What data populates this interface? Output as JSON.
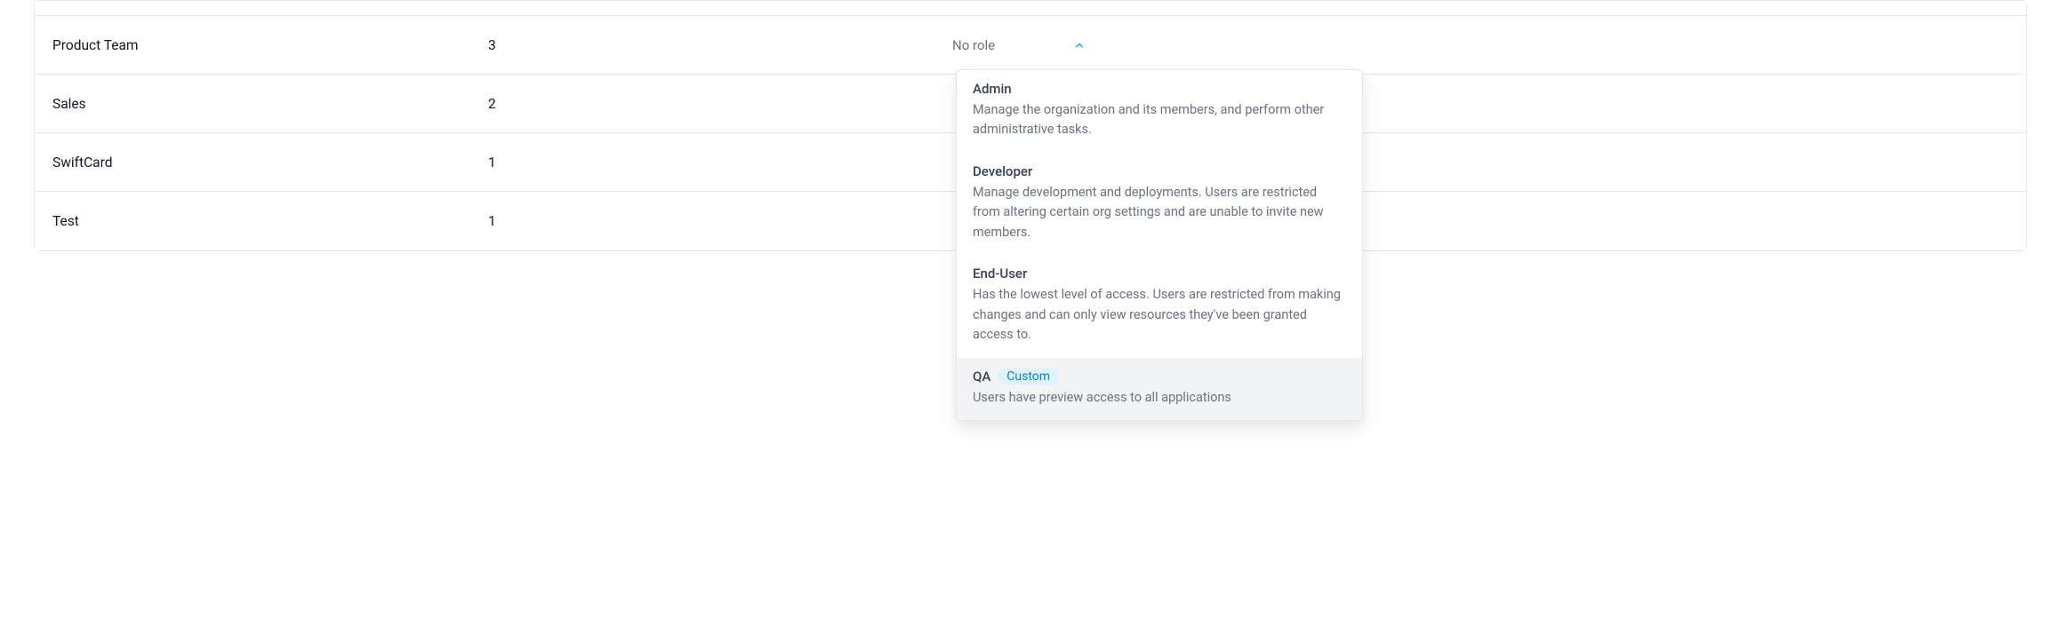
{
  "table": {
    "rows": [
      {
        "name": "Product Team",
        "count": "3",
        "role": "No role"
      },
      {
        "name": "Sales",
        "count": "2",
        "role": ""
      },
      {
        "name": "SwiftCard",
        "count": "1",
        "role": ""
      },
      {
        "name": "Test",
        "count": "1",
        "role": ""
      }
    ]
  },
  "roleDropdown": {
    "options": [
      {
        "title": "Admin",
        "desc": "Manage the organization and its members, and perform other administrative tasks.",
        "badge": "",
        "highlighted": false
      },
      {
        "title": "Developer",
        "desc": "Manage development and deployments. Users are restricted from altering certain org settings and are unable to invite new members.",
        "badge": "",
        "highlighted": false
      },
      {
        "title": "End-User",
        "desc": "Has the lowest level of access. Users are restricted from making changes and can only view resources they've been granted access to.",
        "badge": "",
        "highlighted": false
      },
      {
        "title": "QA",
        "desc": "Users have preview access to all applications",
        "badge": "Custom",
        "highlighted": true
      }
    ]
  }
}
